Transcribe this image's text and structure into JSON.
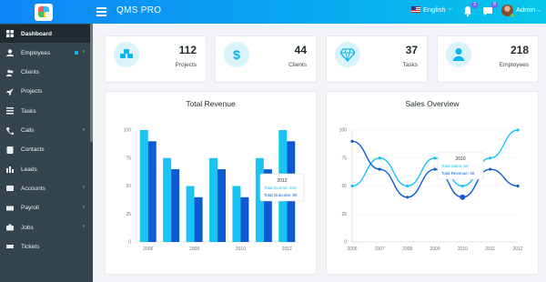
{
  "topbar": {
    "brand": "QMS PRO",
    "language": "English",
    "notification_count": "3",
    "message_count": "8",
    "user_name": "Admin"
  },
  "sidebar": {
    "items": [
      {
        "label": "Dashboard",
        "icon": "dashboard-icon",
        "active": true
      },
      {
        "label": "Employees",
        "icon": "user-icon",
        "submenu": true
      },
      {
        "label": "Clients",
        "icon": "users-icon"
      },
      {
        "label": "Projects",
        "icon": "rocket-icon"
      },
      {
        "label": "Tasks",
        "icon": "tasks-icon"
      },
      {
        "label": "Calls",
        "icon": "phone-icon",
        "submenu": true
      },
      {
        "label": "Contacts",
        "icon": "contacts-icon"
      },
      {
        "label": "Leads",
        "icon": "leads-icon"
      },
      {
        "label": "Accounts",
        "icon": "accounts-icon",
        "submenu": true
      },
      {
        "label": "Payroll",
        "icon": "payroll-icon",
        "submenu": true
      },
      {
        "label": "Jobs",
        "icon": "briefcase-icon",
        "submenu": true
      },
      {
        "label": "Tickets",
        "icon": "ticket-icon"
      }
    ]
  },
  "stats": [
    {
      "value": "112",
      "label": "Projects",
      "icon": "cubes-icon"
    },
    {
      "value": "44",
      "label": "Clients",
      "icon": "dollar-icon"
    },
    {
      "value": "37",
      "label": "Tasks",
      "icon": "diamond-icon"
    },
    {
      "value": "218",
      "label": "Employees",
      "icon": "user-icon"
    }
  ],
  "colors": {
    "accent": "#0ab4ee",
    "light_series": "#19c4f5",
    "dark_series": "#0c5bd3",
    "sidebar": "#34444c"
  },
  "chart_data": [
    {
      "type": "bar",
      "title": "Total Revenue",
      "categories": [
        "2006",
        "2007",
        "2008",
        "2009",
        "2010",
        "2011",
        "2012"
      ],
      "x_tick_labels": [
        "2006",
        "2008",
        "2010",
        "2012"
      ],
      "series": [
        {
          "name": "Total Income",
          "values": [
            100,
            75,
            50,
            75,
            50,
            75,
            100
          ]
        },
        {
          "name": "Total Outcome",
          "values": [
            90,
            65,
            40,
            65,
            40,
            65,
            90
          ]
        }
      ],
      "ylim": [
        0,
        100
      ],
      "yticks": [
        "0",
        "25",
        "50",
        "75",
        "100"
      ],
      "tooltip": {
        "category": "2012",
        "lines": [
          "Total Income: 100",
          "Total Outcome: 90"
        ]
      }
    },
    {
      "type": "line",
      "title": "Sales Overview",
      "categories": [
        "2006",
        "2007",
        "2008",
        "2009",
        "2010",
        "2011",
        "2012"
      ],
      "series": [
        {
          "name": "Total Sales",
          "values": [
            50,
            75,
            50,
            75,
            50,
            75,
            100
          ]
        },
        {
          "name": "Total Revenue",
          "values": [
            90,
            65,
            40,
            65,
            40,
            65,
            50
          ]
        }
      ],
      "ylim": [
        0,
        100
      ],
      "yticks": [
        "0",
        "25",
        "50",
        "75",
        "100"
      ],
      "tooltip": {
        "category": "2010",
        "lines": [
          "Total Sales: 50",
          "Total Revenue: 40"
        ]
      }
    }
  ]
}
